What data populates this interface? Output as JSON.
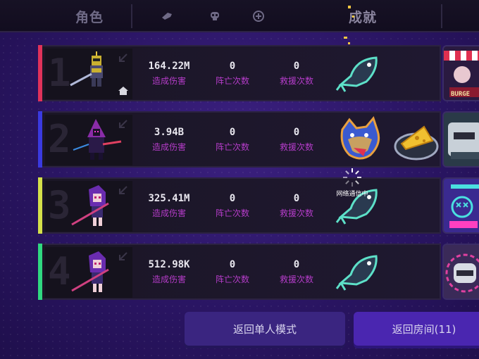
{
  "tabs": {
    "roles": "角色",
    "achievements": "成就"
  },
  "players": [
    {
      "rank": "1",
      "damage": "164.22M",
      "damage_label": "造成伤害",
      "deaths": "0",
      "deaths_label": "阵亡次数",
      "rescues": "0",
      "rescues_label": "救援次数",
      "stripe_color": "#e0325a",
      "badges": [
        "fish-badge"
      ],
      "host": true
    },
    {
      "rank": "2",
      "damage": "3.94B",
      "damage_label": "造成伤害",
      "deaths": "0",
      "deaths_label": "阵亡次数",
      "rescues": "0",
      "rescues_label": "救援次数",
      "stripe_color": "#3a3ae0",
      "badges": [
        "wolf-badge",
        "cheese-badge"
      ],
      "host": false
    },
    {
      "rank": "3",
      "damage": "325.41M",
      "damage_label": "造成伤害",
      "deaths": "0",
      "deaths_label": "阵亡次数",
      "rescues": "0",
      "rescues_label": "救援次数",
      "stripe_color": "#d4e04a",
      "badges": [
        "fish-badge"
      ],
      "host": false
    },
    {
      "rank": "4",
      "damage": "512.98K",
      "damage_label": "造成伤害",
      "deaths": "0",
      "deaths_label": "阵亡次数",
      "rescues": "0",
      "rescues_label": "救援次数",
      "stripe_color": "#30d880",
      "badges": [
        "fish-badge"
      ],
      "host": false
    }
  ],
  "sidecards": {
    "first_label": "BURGE"
  },
  "loading_text": "网络通信中",
  "buttons": {
    "single_mode": "返回单人模式",
    "room": "返回房间(11)"
  },
  "colors": {
    "accent_label": "#b43cc8",
    "primary_button": "#4a26b0"
  }
}
